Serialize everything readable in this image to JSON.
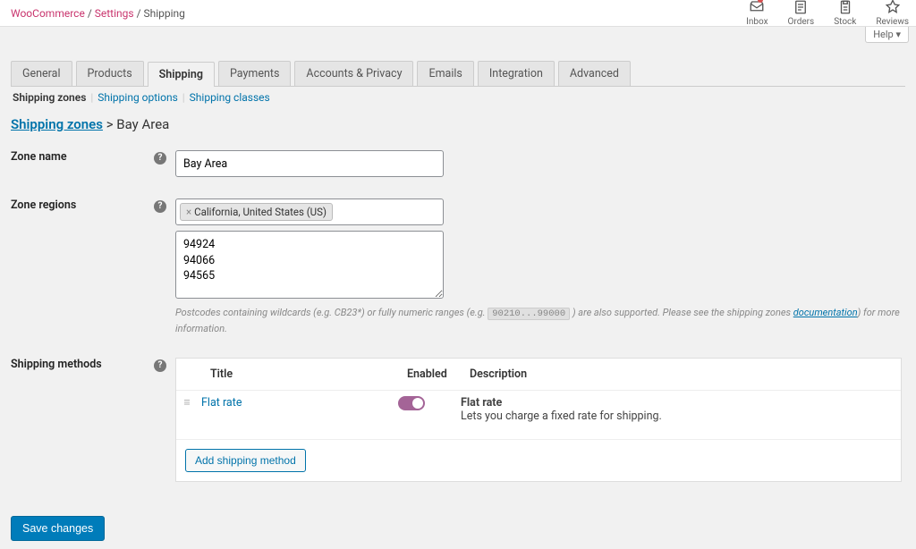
{
  "breadcrumb": {
    "a": "WooCommerce",
    "b": "Settings",
    "c": "Shipping"
  },
  "admin_icons": {
    "inbox": "Inbox",
    "orders": "Orders",
    "stock": "Stock",
    "reviews": "Reviews"
  },
  "help_label": "Help ▾",
  "tabs": [
    "General",
    "Products",
    "Shipping",
    "Payments",
    "Accounts & Privacy",
    "Emails",
    "Integration",
    "Advanced"
  ],
  "active_tab_index": 2,
  "subtabs": {
    "zones": "Shipping zones",
    "options": "Shipping options",
    "classes": "Shipping classes"
  },
  "heading": {
    "link": "Shipping zones",
    "sep": " > ",
    "current": "Bay Area"
  },
  "labels": {
    "zone_name": "Zone name",
    "zone_regions": "Zone regions",
    "shipping_methods": "Shipping methods"
  },
  "zone_name_value": "Bay Area",
  "region_token": "California, United States (US)",
  "postcodes": "94924\n94066\n94565",
  "hint": {
    "pre": "Postcodes containing wildcards (e.g. CB23*) or fully numeric ranges (e.g. ",
    "code": "90210...99000",
    "mid": " ) are also supported. Please see the shipping zones ",
    "doclink": "documentation",
    "post": ") for more information."
  },
  "methods_table": {
    "cols": {
      "title": "Title",
      "enabled": "Enabled",
      "desc": "Description"
    },
    "row": {
      "title": "Flat rate",
      "desc_title": "Flat rate",
      "desc_body": "Lets you charge a fixed rate for shipping."
    },
    "add_button": "Add shipping method"
  },
  "save_button": "Save changes"
}
